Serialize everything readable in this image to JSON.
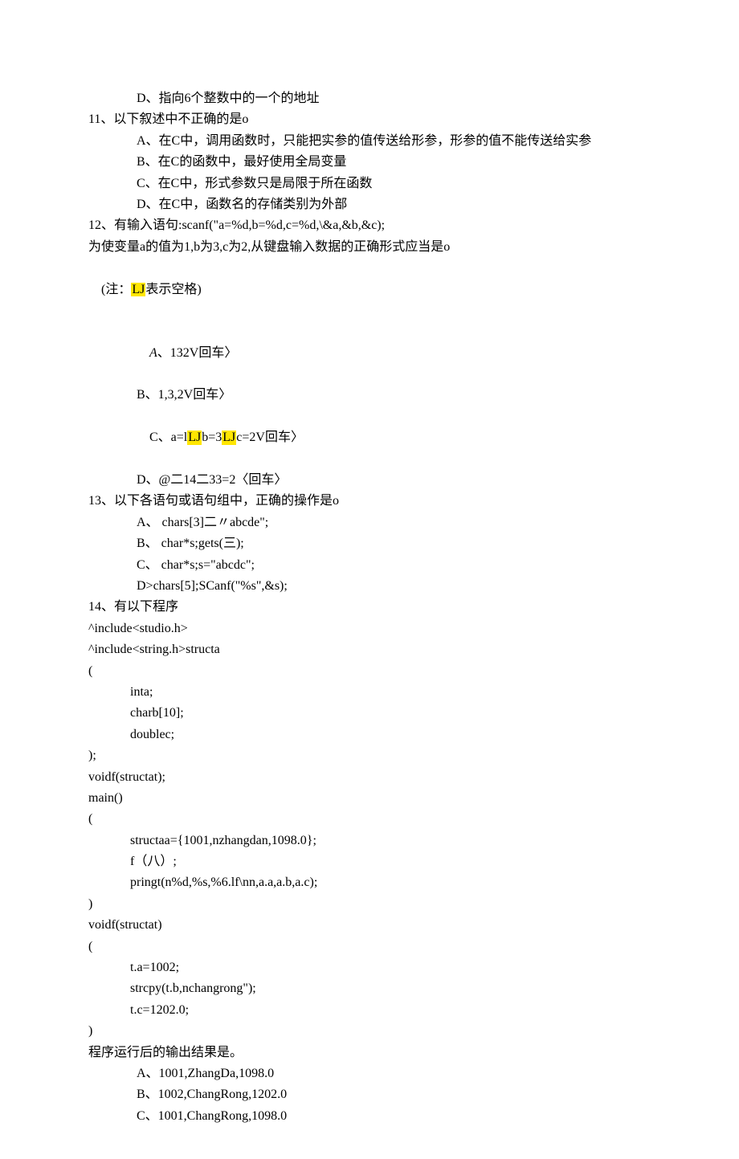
{
  "l1": "D、指向6个整数中的一个的地址",
  "l2": "11、以下叙述中不正确的是o",
  "l3": "A、在C中，调用函数时，只能把实参的值传送给形参，形参的值不能传送给实参",
  "l4": "B、在C的函数中，最好使用全局变量",
  "l5": "C、在C中，形式参数只是局限于所在函数",
  "l6": "D、在C中，函数名的存储类别为外部",
  "l7": "12、有输入语句:scanf(\"a=%d,b=%d,c=%d,\\&a,&b,&c);",
  "l8": "为使变量a的值为1,b为3,c为2,从键盘输入数据的正确形式应当是o",
  "l9a": "(注：",
  "l9hl": "LJ",
  "l9b": "表示空格)",
  "l10a": "A",
  "l10b": "、132V回车〉",
  "l11": "B、1,3,2V回车〉",
  "l12a": "C、a=l",
  "l12hl1": "LJ",
  "l12b": "b=3",
  "l12hl2": "LJ",
  "l12c": "c=2V回车〉",
  "l13": "D、@二14二33=2〈回车〉",
  "l14": "13、以下各语句或语句组中，正确的操作是o",
  "l15": "A、 chars[3]二〃abcde\";",
  "l16": "B、 char*s;gets(三);",
  "l17": "C、 char*s;s=\"abcdc\";",
  "l18": "D>chars[5];SCanf(\"%s\",&s);",
  "l19": "14、有以下程序",
  "l20": "^include<studio.h>",
  "l21": "^include<string.h>structa",
  "l22": "(",
  "l23": "inta;",
  "l24": "charb[10];",
  "l25": "doublec;",
  "l26": ");",
  "l27": "voidf(structat);",
  "l28": "main()",
  "l29": "(",
  "l30": "structaa={1001,nzhangdan,1098.0};",
  "l31": "f（八）;",
  "l32": "pringt(n%d,%s,%6.lf\\nn,a.a,a.b,a.c);",
  "l33": ")",
  "l34": "voidf(structat)",
  "l35": "(",
  "l36": "t.a=1002;",
  "l37": "strcpy(t.b,nchangrong\");",
  "l38": "t.c=1202.0;",
  "l39": ")",
  "l40": "程序运行后的输出结果是。",
  "l41": "A、1001,ZhangDa,1098.0",
  "l42": "B、1002,ChangRong,1202.0",
  "l43": "C、1001,ChangRong,1098.0"
}
